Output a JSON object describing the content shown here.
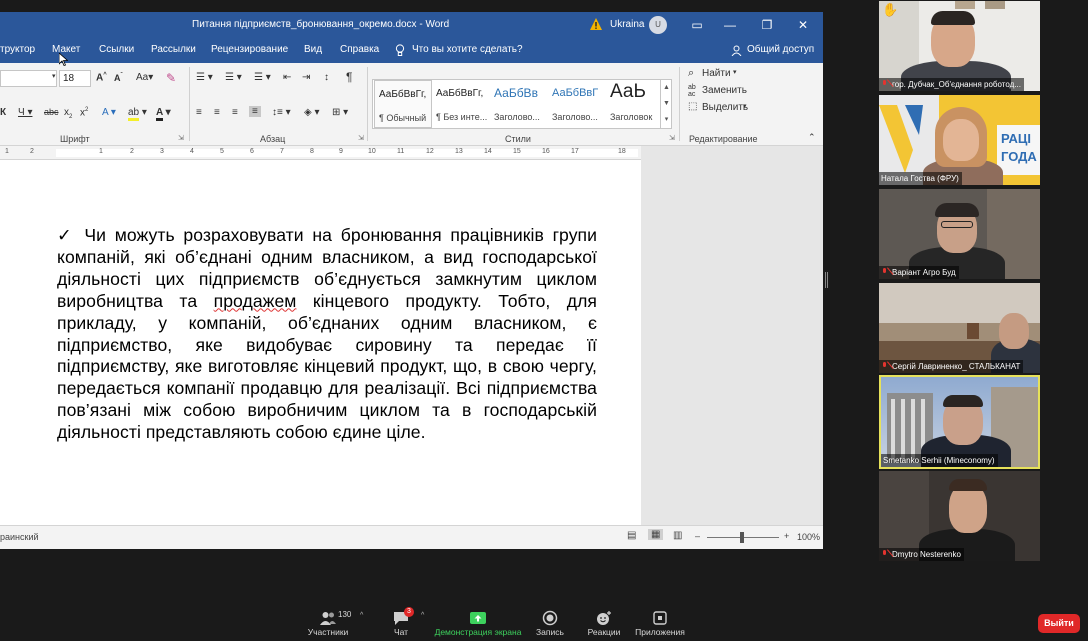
{
  "word": {
    "title": "Питання підприємств_бронювання_окремо.docx  -  Word",
    "account_region": "Ukraina",
    "avatar_initial": "U",
    "menu": [
      "труктор",
      "Макет",
      "Ссылки",
      "Рассылки",
      "Рецензирование",
      "Вид",
      "Справка"
    ],
    "tell_me": "Что вы хотите сделать?",
    "share": "Общий доступ",
    "font_size": "18",
    "font_group": "Шрифт",
    "paragraph_group": "Абзац",
    "styles_group": "Стили",
    "editing_group": "Редактирование",
    "styles": [
      {
        "sample": "АаБбВвГг,",
        "name": "¶ Обычный"
      },
      {
        "sample": "АаБбВвГг,",
        "name": "¶ Без инте..."
      },
      {
        "sample": "АаБбВв",
        "name": "Заголово..."
      },
      {
        "sample": "АаБбВвГ",
        "name": "Заголово..."
      },
      {
        "sample": "АаЬ",
        "name": "Заголовок"
      }
    ],
    "find": "Найти",
    "replace": "Заменить",
    "select": "Выделить",
    "ruler_numbers": [
      "1",
      "2",
      "1",
      "2",
      "3",
      "4",
      "5",
      "6",
      "7",
      "8",
      "9",
      "10",
      "11",
      "12",
      "13",
      "14",
      "15",
      "16",
      "17",
      "18"
    ],
    "doc_text_before_spell": "✓  Чи можуть розраховувати на бронювання працівників групи компаній, які об’єднані одним власником, а вид господарської діяльності цих підприємств об’єднується замкнутим циклом виробництва та ",
    "doc_text_spell": "продажем",
    "doc_text_after_spell": " кінцевого продукту. Тобто, для прикладу, у компаній, об’єднаних одним власником, є підприємство, яке видобуває сировину та передає її підприємству, яке виготовляє кінцевий продукт, що, в свою чергу, передається компанії продавцю для реалізації. Всі підприємства пов’язані між собою виробничим циклом та в господарській діяльності представляють собою єдине ціле.",
    "status_language": "раинский",
    "zoom": "100%"
  },
  "participants": [
    {
      "name": "гор. Дубчак_Об'єднання роботод...",
      "muted": true,
      "palette": {
        "bg": "#e9e7e2",
        "skin": "#d9a98c",
        "shirt": "#3c3e45"
      }
    },
    {
      "name": "Натала Гоства (ФРУ)",
      "muted": false,
      "palette": {
        "bg": "#f2c233",
        "skin": "#e0b190",
        "shirt": "#8c6b5a"
      }
    },
    {
      "name": "Варіант Агро Буд",
      "muted": true,
      "palette": {
        "bg": "#5f5a55",
        "skin": "#c9a08a",
        "shirt": "#252525"
      }
    },
    {
      "name": "Сергій Лавриненко_ СТАЛЬКАНАТ",
      "muted": true,
      "palette": {
        "bg": "#9a8a78",
        "skin": "#c99e84",
        "shirt": "#2e3440"
      }
    },
    {
      "name": "Smetanko Serhii (Mineconomy)",
      "muted": false,
      "palette": {
        "bg": "#7e96b8",
        "skin": "#caa08a",
        "shirt": "#1f2430"
      }
    },
    {
      "name": "Dmytro Nesterenko",
      "muted": true,
      "palette": {
        "bg": "#3a3633",
        "skin": "#d0a48a",
        "shirt": "#1e1e1e"
      }
    }
  ],
  "zoom_toolbar": {
    "participants_label": "Участники",
    "participants_count": "130",
    "chat_label": "Чат",
    "chat_badge": "3",
    "share_label": "Демонстрация экрана",
    "record_label": "Запись",
    "reactions_label": "Реакции",
    "apps_label": "Приложения",
    "leave_label": "Выйти"
  },
  "colors": {
    "word_blue": "#2b579a",
    "share_green": "#3dd15d",
    "leave_red": "#e02828",
    "active_speaker": "#e6e15a"
  }
}
